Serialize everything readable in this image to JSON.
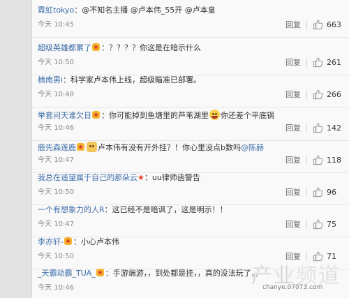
{
  "comments": [
    {
      "user": "霓虹tokyo",
      "text": "：@不知名主播 @卢本伟_55开 @卢本皇",
      "time": "今天 10:45",
      "reply": "回复",
      "likes": "663"
    },
    {
      "user": "超级英雄都累了",
      "text": "：？？？？你这是在暗示什么",
      "time": "今天 10:50",
      "reply": "回复",
      "likes": "261"
    },
    {
      "user": "楠南男i",
      "text": "：科学家卢本伟上线，超级瞄准已部署。",
      "time": "今天 10:48",
      "reply": "回复",
      "likes": "266"
    },
    {
      "user": "举套问天谁欠日",
      "text_a": "：你可能掉到鱼塘里的芦苇湖里",
      "text_b": "你还差个平底锅",
      "time": "今天 10:46",
      "reply": "回复",
      "likes": "142"
    },
    {
      "user": "鹿先森莲鹿",
      "text_a": "卢本伟有没有开外挂？！你心里没点b数吗",
      "text_b": "@陈赫",
      "time": "今天 10:47",
      "reply": "回复",
      "likes": "118"
    },
    {
      "user": "我总在遥望属于自己的那朵云",
      "text": "：uu律师函警告",
      "time": "今天 10:50",
      "reply": "回复",
      "likes": "96"
    },
    {
      "user": "一个有想象力的人R",
      "text": "：这已经不是暗讽了，这是明示！！",
      "time": "今天 10:47",
      "reply": "回复",
      "likes": "75"
    },
    {
      "user": "李亦轩-",
      "text": "：小心卢本伟",
      "time": "今天 10:50",
      "reply": "回复",
      "likes": "71"
    },
    {
      "user": "_天霸动霸_TUA_",
      "text": "：手游端游，，到处都是挂，，真的没法玩了，，",
      "time": "今天 10:46",
      "reply": "回复",
      "likes": ""
    }
  ],
  "watermark": {
    "title": "产业频道",
    "url": "chanye.07073.com"
  },
  "colors": {
    "username": "#3d6da8",
    "text": "#333333",
    "time": "#888888"
  }
}
